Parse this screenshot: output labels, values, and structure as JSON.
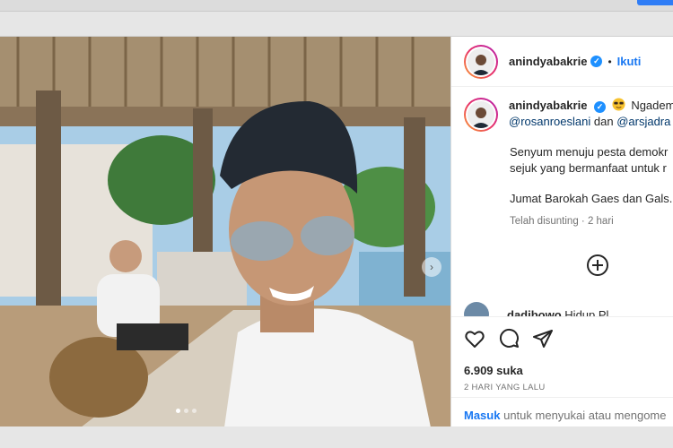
{
  "post": {
    "username": "anindyabakrie",
    "follow_label": "Ikuti",
    "separator": "•",
    "caption_user": "anindyabakrie",
    "caption_first": "Ngadem...",
    "mention_1": "@rosanroeslani",
    "conj": "dan",
    "mention_2": "@arsjadra",
    "caption_line_1": "Senyum menuju pesta demokr",
    "caption_line_2": "sejuk yang bermanfaat untuk r",
    "caption_line_3": "Jumat Barokah Gaes dan Gals...",
    "edited_label": "Telah disunting · 2 hari",
    "next_comment_user": "dadibowo",
    "next_comment_text": "Hidup Pl",
    "likes": "6.909 suka",
    "date": "2 HARI YANG LALU",
    "login_label": "Masuk",
    "login_rest": "untuk menyukai atau mengome"
  },
  "icons": {
    "verified": "verified-badge-icon",
    "like": "heart-icon",
    "comment": "comment-icon",
    "share": "paper-plane-icon",
    "add": "plus-circle-icon",
    "emoji": "sunglasses-emoji-icon",
    "next": "chevron-right-icon"
  },
  "colors": {
    "accent": "#1877f2",
    "mention": "#00376b",
    "muted": "#737373"
  },
  "carousel": {
    "count": 3,
    "active_index": 0
  }
}
